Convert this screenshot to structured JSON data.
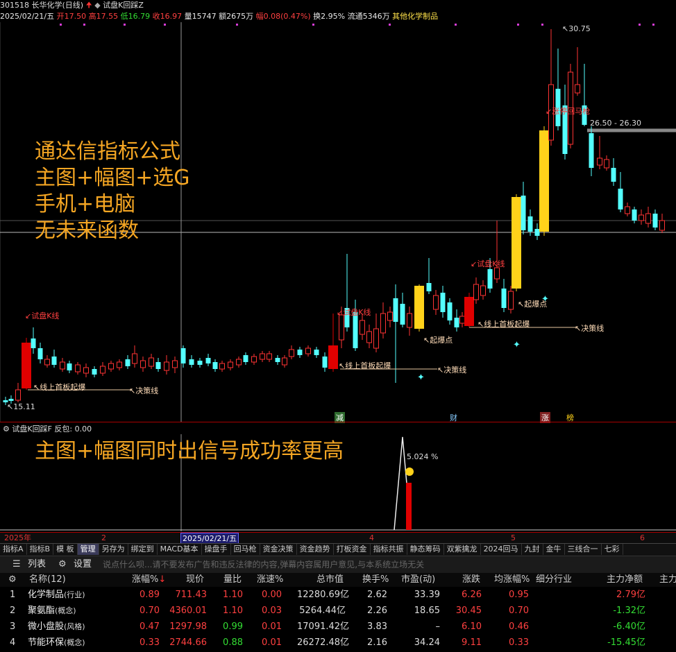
{
  "header": {
    "code": "301518",
    "name": "长华化学(日线)",
    "indicator": "试盘K回踩Z",
    "date": "2025/02/21/五",
    "open_label": "开",
    "open": "17.50",
    "high_label": "高",
    "high": "17.55",
    "low_label": "低",
    "low": "16.79",
    "close_label": "收",
    "close": "16.97",
    "vol_label": "量",
    "vol": "15747",
    "amount_label": "额",
    "amount": "2675万",
    "change_label": "幅",
    "change": "0.08(0.47%)",
    "turnover_label": "换",
    "turnover": "2.95%",
    "float_label": "流通",
    "float_shares": "5346万",
    "sector": "其他化学制品"
  },
  "main_chart": {
    "high_label": "30.75",
    "low_label": "15.11",
    "range_label": "26.50 - 26.30",
    "overlay_lines": [
      "通达信指标公式",
      "主图+幅图+选G",
      "手机+电脑",
      "无未来函数"
    ],
    "annotations": {
      "trial_k_1": "试盘K线",
      "trial_k_2": "试盘K线",
      "trial_k_3": "试盘K线",
      "first_board_1": "线上首板起爆",
      "first_board_2": "线上首板起爆",
      "first_board_3": "线上首板起爆",
      "decision_1": "决策线",
      "decision_2": "决策线",
      "decision_3": "决策线",
      "explode_1": "起爆点",
      "explode_2": "起爆点",
      "pullback": "涨停回马枪"
    },
    "bottom_markers": [
      "减",
      "财",
      "涨",
      "榜"
    ]
  },
  "sub_chart": {
    "title": "试盘K回踩F",
    "value_label": "反包: 0.00",
    "overlay": "主图+幅图同时出信号成功率更高",
    "peak_label": "5.024 %"
  },
  "date_axis": {
    "labels": [
      "2025年",
      "2",
      "2025/02/21/五",
      "4",
      "5",
      "6"
    ]
  },
  "tabs": [
    "指标A",
    "指标B",
    "模 板",
    "管理",
    "另存为",
    "绑定到",
    "MACD基本",
    "操盘手",
    "回马枪",
    "资金决策",
    "资金趋势",
    "打板资金",
    "指标共振",
    "静态筹码",
    "双紫擒龙",
    "2024回马",
    "九封",
    "金牛",
    "三线合一",
    "七彩"
  ],
  "active_tab": "管理",
  "toolbar": {
    "list_label": "列表",
    "settings_label": "设置",
    "comment_placeholder": "说点什么呗...请不要发布广告和违反法律的内容,弹幕内容属用户意见,与本系统立场无关"
  },
  "table": {
    "columns": [
      "名称(12)",
      "涨幅%",
      "现价",
      "量比",
      "涨速%",
      "总市值",
      "换手%",
      "市盈(动)",
      "涨跌",
      "均涨幅%",
      "细分行业",
      "主力净额",
      "主力"
    ],
    "rows": [
      {
        "idx": "1",
        "name": "化学制品",
        "tag": "(行业)",
        "chg": "0.89",
        "price": "711.43",
        "vr": "1.10",
        "spd": "0.00",
        "mcap": "12280.69亿",
        "turn": "2.62",
        "pe": "33.39",
        "diff": "6.26",
        "avg": "0.95",
        "ind": "",
        "net": "2.79亿",
        "net_color": "#ff4040",
        "vr_color": "#ff4040"
      },
      {
        "idx": "2",
        "name": "聚氨酯",
        "tag": "(概念)",
        "chg": "0.70",
        "price": "4360.01",
        "vr": "1.10",
        "spd": "0.03",
        "mcap": "5264.44亿",
        "turn": "2.26",
        "pe": "18.65",
        "diff": "30.45",
        "avg": "0.70",
        "ind": "",
        "net": "-1.32亿",
        "net_color": "#33dd33",
        "vr_color": "#ff4040"
      },
      {
        "idx": "3",
        "name": "微小盘股",
        "tag": "(风格)",
        "chg": "0.47",
        "price": "1297.98",
        "vr": "0.99",
        "spd": "0.01",
        "mcap": "17091.42亿",
        "turn": "3.83",
        "pe": "–",
        "diff": "6.10",
        "avg": "0.46",
        "ind": "",
        "net": "-6.40亿",
        "net_color": "#33dd33",
        "vr_color": "#33dd33"
      },
      {
        "idx": "4",
        "name": "节能环保",
        "tag": "(概念)",
        "chg": "0.33",
        "price": "2744.66",
        "vr": "0.88",
        "spd": "0.01",
        "mcap": "26272.48亿",
        "turn": "2.16",
        "pe": "34.24",
        "diff": "9.11",
        "avg": "0.33",
        "ind": "",
        "net": "-15.45亿",
        "net_color": "#33dd33",
        "vr_color": "#33dd33"
      }
    ]
  },
  "colors": {
    "up": "#ff3333",
    "down": "#54ffff",
    "gold": "#ffd21a",
    "text_orange": "#f5a623"
  }
}
